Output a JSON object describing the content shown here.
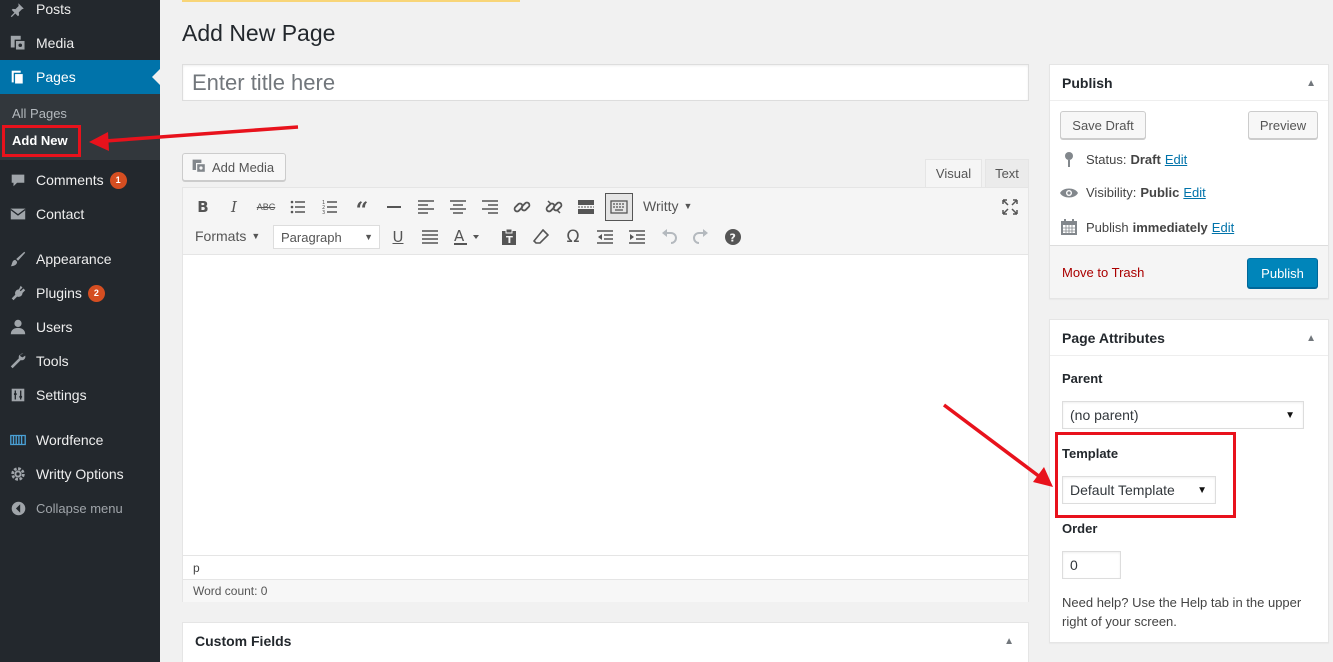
{
  "sidebar": {
    "items": [
      {
        "label": "Posts",
        "icon": "pin-icon"
      },
      {
        "label": "Media",
        "icon": "media-icon"
      },
      {
        "label": "Pages",
        "icon": "pages-icon"
      },
      {
        "label": "Comments",
        "icon": "comment-icon",
        "badge": "1"
      },
      {
        "label": "Contact",
        "icon": "envelope-icon"
      },
      {
        "label": "Appearance",
        "icon": "brush-icon"
      },
      {
        "label": "Plugins",
        "icon": "plugin-icon",
        "badge": "2"
      },
      {
        "label": "Users",
        "icon": "user-icon"
      },
      {
        "label": "Tools",
        "icon": "wrench-icon"
      },
      {
        "label": "Settings",
        "icon": "settings-icon"
      },
      {
        "label": "Wordfence",
        "icon": "wordfence-icon"
      },
      {
        "label": "Writty Options",
        "icon": "gear-icon"
      }
    ],
    "submenu": [
      "All Pages",
      "Add New"
    ],
    "collapse_label": "Collapse menu"
  },
  "main": {
    "page_title": "Add New Page",
    "title_placeholder": "Enter title here",
    "add_media_label": "Add Media",
    "tabs": [
      "Visual",
      "Text"
    ],
    "toolbar": {
      "writty_label": "Writty",
      "formats_label": "Formats",
      "paragraph_label": "Paragraph"
    },
    "status_path": "p",
    "word_count": "Word count: 0",
    "custom_fields_title": "Custom Fields"
  },
  "publish_box": {
    "title": "Publish",
    "save_draft": "Save Draft",
    "preview": "Preview",
    "status_label": "Status:",
    "status_value": "Draft",
    "visibility_label": "Visibility:",
    "visibility_value": "Public",
    "publish_label": "Publish",
    "publish_value": "immediately",
    "edit_label": "Edit",
    "trash_label": "Move to Trash",
    "publish_button": "Publish"
  },
  "attributes_box": {
    "title": "Page Attributes",
    "parent_label": "Parent",
    "parent_value": "(no parent)",
    "template_label": "Template",
    "template_value": "Default Template",
    "order_label": "Order",
    "order_value": "0",
    "help_text": "Need help? Use the Help tab in the upper right of your screen."
  },
  "colors": {
    "sidebar_bg": "#23282d",
    "current_menu": "#0073aa",
    "publish_button": "#0085ba",
    "annotation_red": "#e8121c",
    "badge": "#d54e21"
  }
}
